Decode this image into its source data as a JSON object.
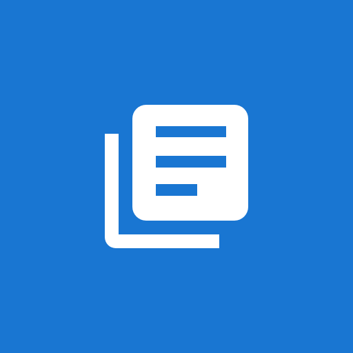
{
  "app_icon": {
    "background_color": "#1976D2",
    "glyph_color": "#FFFFFF",
    "glyph": "library-documents-icon"
  }
}
